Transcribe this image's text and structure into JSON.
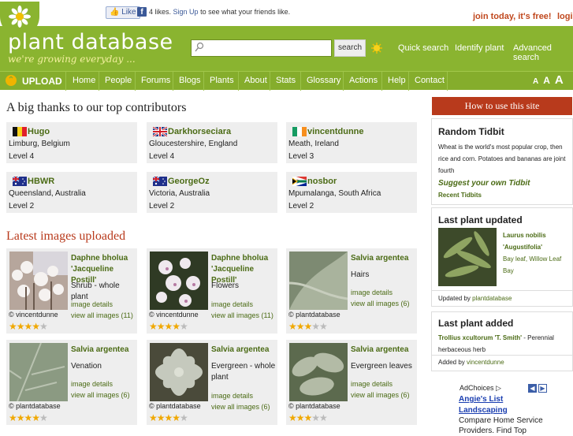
{
  "facebook": {
    "like_label": "Like",
    "likes": "4 likes.",
    "signup": "Sign Up",
    "rest": "to see what your friends like."
  },
  "header": {
    "join": "join today, it's free!",
    "login": "login",
    "site_name": "plant database",
    "tagline": "we're growing everyday ...",
    "search_placeholder": "",
    "search_button": "search",
    "links": [
      "Quick search",
      "Identify plant",
      "Advanced search"
    ]
  },
  "nav": {
    "upload": "UPLOAD",
    "items": [
      "Home",
      "People",
      "Forums",
      "Blogs",
      "Plants",
      "About",
      "Stats",
      "Glossary",
      "Actions",
      "Help",
      "Contact"
    ],
    "font_sizes": [
      "A",
      "A",
      "A"
    ]
  },
  "contributors": {
    "title": "A big thanks to our top contributors",
    "items": [
      {
        "name": "Hugo",
        "location": "Limburg, Belgium",
        "level": "Level 4",
        "flag": "belgium-flag"
      },
      {
        "name": "Darkhorseciara",
        "location": "Gloucestershire, England",
        "level": "Level 4",
        "flag": "uk-flag"
      },
      {
        "name": "vincentdunne",
        "location": "Meath, Ireland",
        "level": "Level 3",
        "flag": "ireland-flag"
      },
      {
        "name": "HBWR",
        "location": "Queensland, Australia",
        "level": "Level 2",
        "flag": "australia-flag"
      },
      {
        "name": "GeorgeOz",
        "location": "Victoria, Australia",
        "level": "Level 2",
        "flag": "australia-flag"
      },
      {
        "name": "nosbor",
        "location": "Mpumalanga, South Africa",
        "level": "Level 2",
        "flag": "south-africa-flag"
      }
    ]
  },
  "latest": {
    "title": "Latest images uploaded",
    "details_label": "image details",
    "items": [
      {
        "title1": "Daphne bholua",
        "title2": "'Jacqueline Postill'",
        "desc1": "Shrub - whole plant",
        "desc2": "",
        "all": "view all images (11)",
        "credit": "© vincentdunne",
        "stars": 3.5,
        "thumb": "shrub"
      },
      {
        "title1": "Daphne bholua",
        "title2": "'Jacqueline Postill'",
        "desc1": "Flowers",
        "desc2": "",
        "all": "view all images (11)",
        "credit": "© vincentdunne",
        "stars": 3.5,
        "thumb": "flowers"
      },
      {
        "title1": "Salvia argentea",
        "title2": "",
        "desc1": "Hairs",
        "desc2": "",
        "all": "view all images (6)",
        "credit": "© plantdatabase",
        "stars": 3,
        "thumb": "hairs"
      },
      {
        "title1": "Salvia argentea",
        "title2": "",
        "desc1": "Venation",
        "desc2": "",
        "all": "view all images (6)",
        "credit": "© plantdatabase",
        "stars": 4,
        "thumb": "leaf"
      },
      {
        "title1": "Salvia argentea",
        "title2": "",
        "desc1": "Evergreen - whole",
        "desc2": "plant",
        "all": "view all images (6)",
        "credit": "© plantdatabase",
        "stars": 3.5,
        "thumb": "rosette"
      },
      {
        "title1": "Salvia argentea",
        "title2": "",
        "desc1": "Evergreen leaves",
        "desc2": "",
        "all": "view all images (6)",
        "credit": "© plantdatabase",
        "stars": 3,
        "thumb": "leaves"
      }
    ]
  },
  "sidebar": {
    "howto": "How to use this site",
    "tidbit": {
      "title": "Random Tidbit",
      "lines": [
        "Wheat is the world's most popular crop, then",
        "rice and corn. Potatoes and bananas are joint",
        "fourth"
      ],
      "suggest": "Suggest your own Tidbit",
      "recent": "Recent Tidbits"
    },
    "updated": {
      "title": "Last plant updated",
      "name1": "Laurus nobilis",
      "name2": "'Augustifolia'",
      "desc1": "Bay leaf, Willow Leaf",
      "desc2": "Bay",
      "by_label": "Updated by",
      "by": "plantdatabase"
    },
    "added": {
      "title": "Last plant added",
      "name": "Trollius xcultorum 'T. Smith'",
      "desc1": " - Perennial",
      "desc2": "herbaceous herb",
      "by_label": "Added by",
      "by": "vincentdunne"
    },
    "ad": {
      "choices": "AdChoices",
      "title1": "Angie's List",
      "title2": "Landscaping",
      "line1": "Compare Home Service",
      "line2": "Providers. Find Top"
    }
  },
  "colors": {
    "header_green": "#8ab430",
    "nav_green": "#85ad2c",
    "link_green": "#4b6b15",
    "accent_red": "#c0481e",
    "howto_red": "#b83a1c"
  }
}
